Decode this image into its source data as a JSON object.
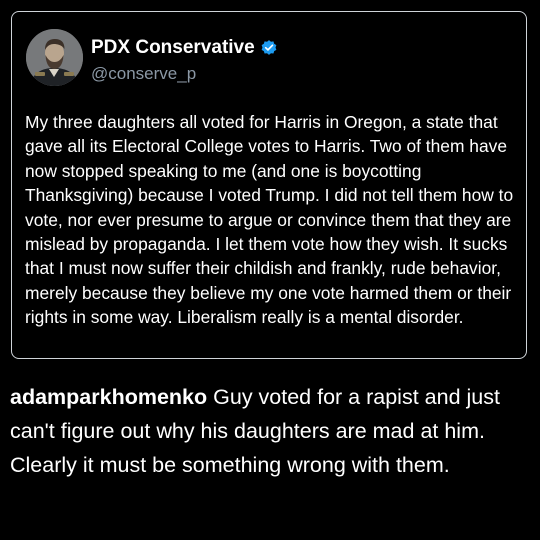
{
  "tweet": {
    "display_name": "PDX Conservative",
    "handle": "@conserve_p",
    "verified": true,
    "verified_color": "#1d9bf0",
    "avatar_icon": "portrait-avatar-icon",
    "text": "My three daughters all voted for Harris in Oregon, a state that gave all its Electoral College votes to Harris. Two of them have now stopped speaking to me (and one is boycotting Thanksgiving) because I voted Trump. I did not tell them how to vote, nor ever presume to argue or convince them that they are mislead by propaganda. I let them vote how they wish. It sucks that I must now suffer their childish and frankly, rude behavior, merely because they believe my one vote harmed them or their rights in some way. Liberalism really is a mental disorder."
  },
  "comment": {
    "username": "adamparkhomenko",
    "text": "Guy voted for a rapist and just can't figure out why his daughters are mad at him. Clearly it must be something wrong with them."
  }
}
